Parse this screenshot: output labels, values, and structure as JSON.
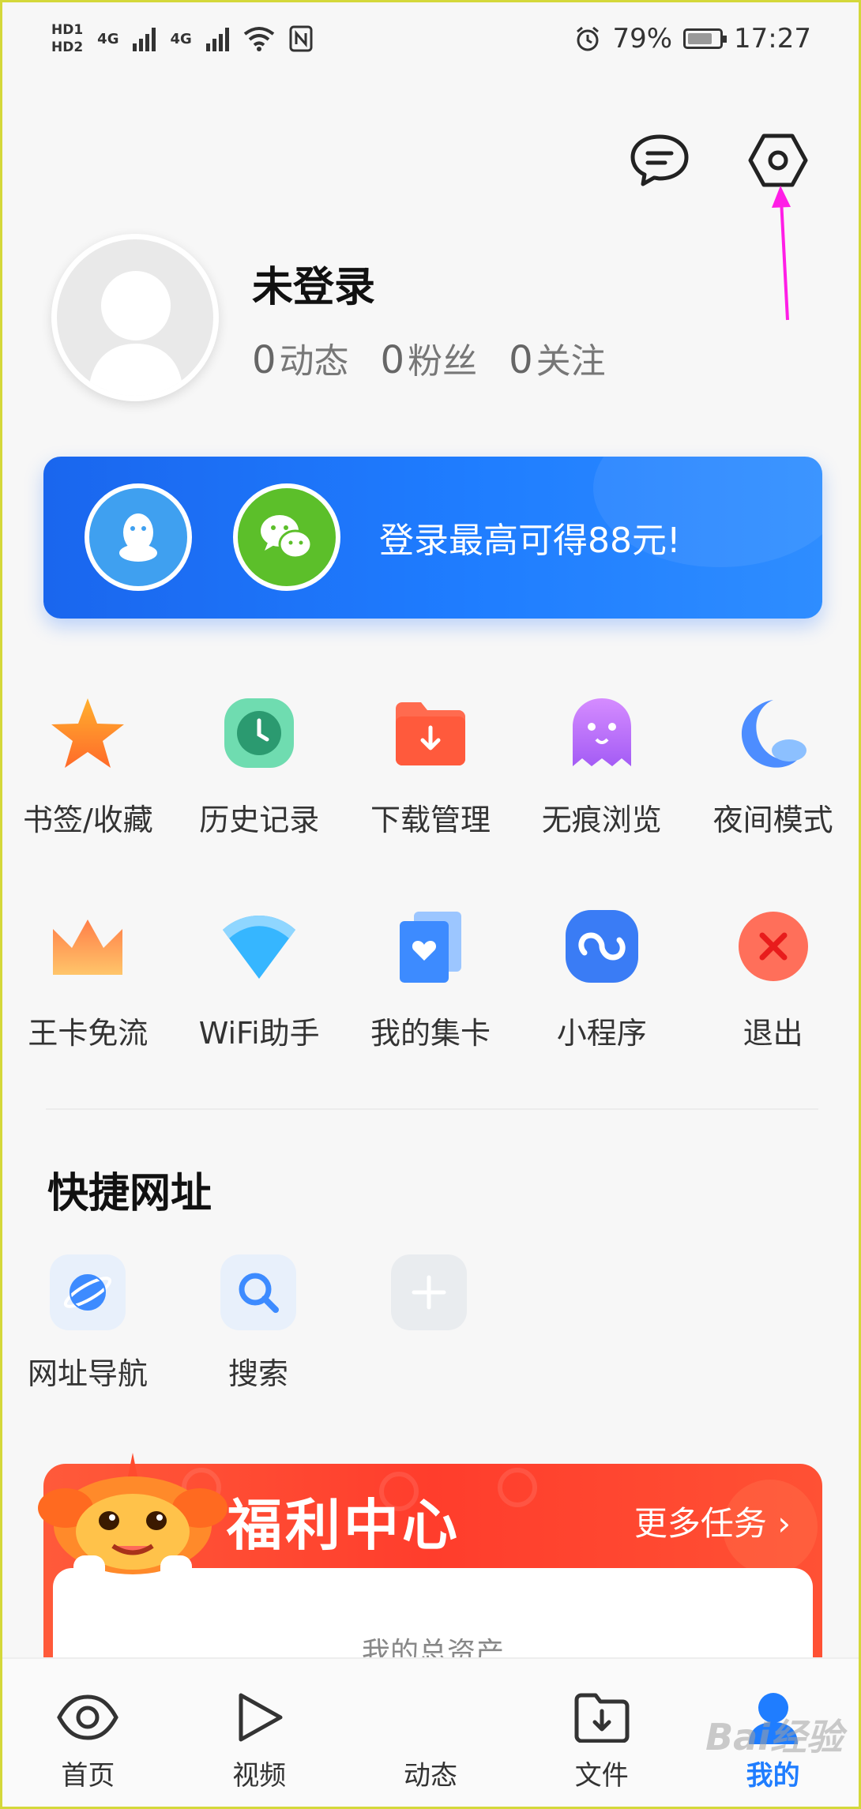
{
  "status_bar": {
    "hd1": "HD1",
    "hd2": "HD2",
    "net1": "4G",
    "net2": "4G",
    "battery": "79%",
    "time": "17:27"
  },
  "profile": {
    "name": "未登录",
    "stats": [
      {
        "count": "0",
        "label": "动态"
      },
      {
        "count": "0",
        "label": "粉丝"
      },
      {
        "count": "0",
        "label": "关注"
      }
    ]
  },
  "login_banner": {
    "text": "登录最高可得88元!"
  },
  "tools_row1": [
    {
      "label": "书签/收藏",
      "icon": "star-icon"
    },
    {
      "label": "历史记录",
      "icon": "clock-icon"
    },
    {
      "label": "下载管理",
      "icon": "download-folder-icon"
    },
    {
      "label": "无痕浏览",
      "icon": "ghost-icon"
    },
    {
      "label": "夜间模式",
      "icon": "moon-icon"
    }
  ],
  "tools_row2": [
    {
      "label": "王卡免流",
      "icon": "crown-icon"
    },
    {
      "label": "WiFi助手",
      "icon": "wifi-icon"
    },
    {
      "label": "我的集卡",
      "icon": "card-heart-icon"
    },
    {
      "label": "小程序",
      "icon": "mini-program-icon"
    },
    {
      "label": "退出",
      "icon": "close-icon"
    }
  ],
  "quick_links": {
    "title": "快捷网址",
    "items": [
      {
        "label": "网址导航",
        "icon": "planet-icon"
      },
      {
        "label": "搜索",
        "icon": "search-icon"
      },
      {
        "label": "",
        "icon": "plus-icon"
      }
    ]
  },
  "welfare": {
    "title": "福利中心",
    "more": "更多任务 ›",
    "asset_label": "我的总资产"
  },
  "bottom_nav": [
    {
      "label": "首页",
      "icon": "eye-icon"
    },
    {
      "label": "视频",
      "icon": "play-icon"
    },
    {
      "label": "动态",
      "icon": "feed-icon"
    },
    {
      "label": "文件",
      "icon": "file-download-icon"
    },
    {
      "label": "我的",
      "icon": "person-icon",
      "active": true
    }
  ],
  "watermark": "Bai经验",
  "colors": {
    "accent": "#1f7dff",
    "welfare_red": "#ff3d2c",
    "annotation": "#ff1ee6"
  }
}
